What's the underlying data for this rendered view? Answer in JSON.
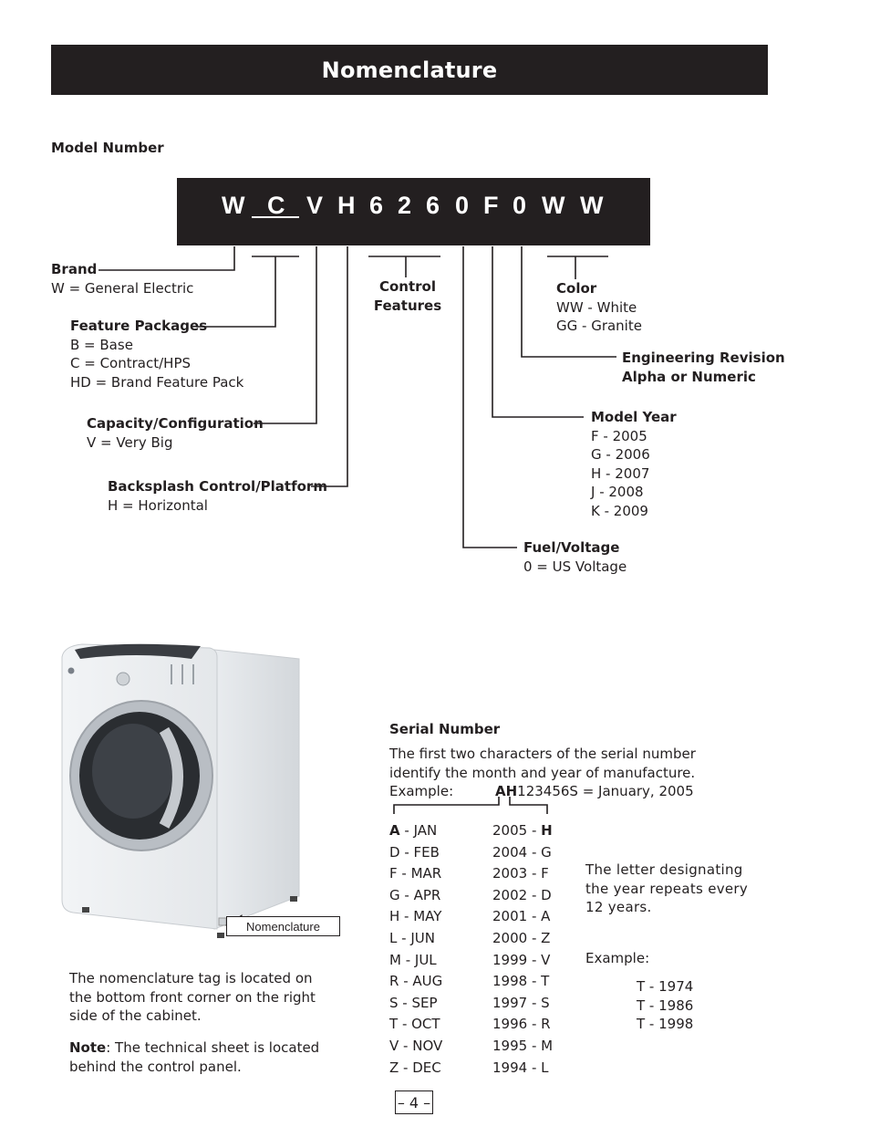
{
  "header": {
    "title": "Nomenclature"
  },
  "model": {
    "section_label": "Model Number",
    "characters": [
      "W",
      "C",
      "V",
      "H",
      "6",
      "2",
      "6",
      "0",
      "F",
      "0",
      "W",
      "W"
    ],
    "fields": {
      "brand": {
        "title": "Brand",
        "lines": [
          "W = General Electric"
        ]
      },
      "feature_packages": {
        "title": "Feature Packages",
        "lines": [
          "B = Base",
          "C = Contract/HPS",
          "HD = Brand Feature Pack"
        ]
      },
      "capacity": {
        "title": "Capacity/Configuration",
        "lines": [
          "V = Very Big"
        ]
      },
      "backsplash": {
        "title": "Backsplash Control/Platform",
        "lines": [
          "H = Horizontal"
        ]
      },
      "control_features": {
        "title_line1": "Control",
        "title_line2": "Features"
      },
      "color": {
        "title": "Color",
        "lines": [
          "WW - White",
          "GG - Granite"
        ]
      },
      "engineering_revision": {
        "title_line1": "Engineering Revision",
        "title_line2": "Alpha or Numeric"
      },
      "model_year": {
        "title": "Model Year",
        "lines": [
          "F - 2005",
          "G - 2006",
          "H - 2007",
          "J - 2008",
          "K - 2009"
        ]
      },
      "fuel_voltage": {
        "title": "Fuel/Voltage",
        "lines": [
          "0 = US Voltage"
        ]
      }
    }
  },
  "image": {
    "subject": "front-load washer",
    "tag_label": "Nomenclature"
  },
  "location_note": {
    "text_lines": [
      "The nomenclature tag is located on",
      "the bottom front corner on the right",
      "side of the cabinet."
    ],
    "note_label": "Note",
    "note_lines": [
      ": The technical sheet is located",
      "behind the control panel."
    ]
  },
  "serial": {
    "section_label": "Serial Number",
    "intro_lines": [
      "The first two characters of the serial number",
      "identify the month and year of manufacture."
    ],
    "example_label": "Example:",
    "example_bold": "AH",
    "example_rest": "123456S = January, 2005",
    "months": [
      {
        "code": "A",
        "name": "JAN"
      },
      {
        "code": "D",
        "name": "FEB"
      },
      {
        "code": "F",
        "name": "MAR"
      },
      {
        "code": "G",
        "name": "APR"
      },
      {
        "code": "H",
        "name": "MAY"
      },
      {
        "code": "L",
        "name": "JUN"
      },
      {
        "code": "M",
        "name": "JUL"
      },
      {
        "code": "R",
        "name": "AUG"
      },
      {
        "code": "S",
        "name": "SEP"
      },
      {
        "code": "T",
        "name": "OCT"
      },
      {
        "code": "V",
        "name": "NOV"
      },
      {
        "code": "Z",
        "name": "DEC"
      }
    ],
    "years": [
      {
        "year": "2005",
        "code": "H"
      },
      {
        "year": "2004",
        "code": "G"
      },
      {
        "year": "2003",
        "code": "F"
      },
      {
        "year": "2002",
        "code": "D"
      },
      {
        "year": "2001",
        "code": "A"
      },
      {
        "year": "2000",
        "code": "Z"
      },
      {
        "year": "1999",
        "code": "V"
      },
      {
        "year": "1998",
        "code": "T"
      },
      {
        "year": "1997",
        "code": "S"
      },
      {
        "year": "1996",
        "code": "R"
      },
      {
        "year": "1995",
        "code": "M"
      },
      {
        "year": "1994",
        "code": "L"
      }
    ],
    "repeat_note_lines": [
      "The letter designating",
      "the year repeats every",
      "12 years."
    ],
    "repeat_example_label": "Example:",
    "repeat_examples": [
      "T - 1974",
      "T - 1986",
      "T - 1998"
    ]
  },
  "footer": {
    "page_number": "– 4 –"
  }
}
